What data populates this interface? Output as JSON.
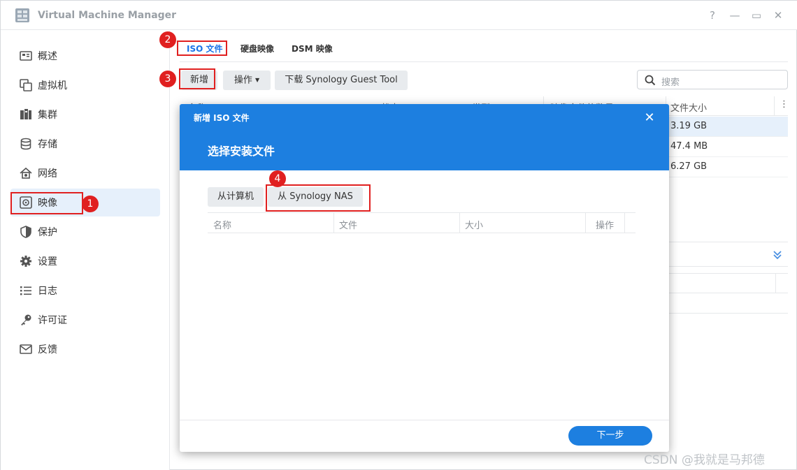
{
  "window": {
    "title": "Virtual Machine Manager",
    "controls": {
      "help": "?",
      "minimize": "—",
      "maximize": "▭",
      "close": "✕"
    }
  },
  "sidebar": {
    "items": [
      {
        "label": "概述",
        "icon": "overview-icon"
      },
      {
        "label": "虚拟机",
        "icon": "virtual-machine-icon"
      },
      {
        "label": "集群",
        "icon": "cluster-icon"
      },
      {
        "label": "存储",
        "icon": "storage-icon"
      },
      {
        "label": "网络",
        "icon": "network-icon"
      },
      {
        "label": "映像",
        "icon": "image-icon",
        "active": true
      },
      {
        "label": "保护",
        "icon": "shield-icon"
      },
      {
        "label": "设置",
        "icon": "gear-icon"
      },
      {
        "label": "日志",
        "icon": "log-list-icon"
      },
      {
        "label": "许可证",
        "icon": "key-icon"
      },
      {
        "label": "反馈",
        "icon": "mail-icon"
      }
    ]
  },
  "tabs": [
    {
      "label": "ISO 文件",
      "active": true
    },
    {
      "label": "硬盘映像"
    },
    {
      "label": "DSM 映像"
    }
  ],
  "toolbar": {
    "add_label": "新增",
    "action_label": "操作",
    "download_label": "下载 Synology Guest Tool",
    "search_placeholder": "搜索"
  },
  "grid": {
    "columns": [
      "名称",
      "状态",
      "类型",
      "映像文件的数量",
      "文件大小"
    ],
    "rows": [
      {
        "size": "3.19 GB"
      },
      {
        "size": "47.4 MB"
      },
      {
        "size": "6.27 GB"
      }
    ]
  },
  "modal": {
    "title": "新增 ISO 文件",
    "subtitle": "选择安装文件",
    "close": "✕",
    "source_buttons": [
      "从计算机",
      "从 Synology NAS"
    ],
    "columns": [
      "名称",
      "文件",
      "大小",
      "操作"
    ],
    "next_label": "下一步"
  },
  "annotations": {
    "markers": [
      "1",
      "2",
      "3",
      "4"
    ],
    "color": "#e02020"
  },
  "colors": {
    "accent": "#1d7fe0",
    "active_nav_bg": "#e6f0fb"
  },
  "watermark": "CSDN @我就是马邦德"
}
